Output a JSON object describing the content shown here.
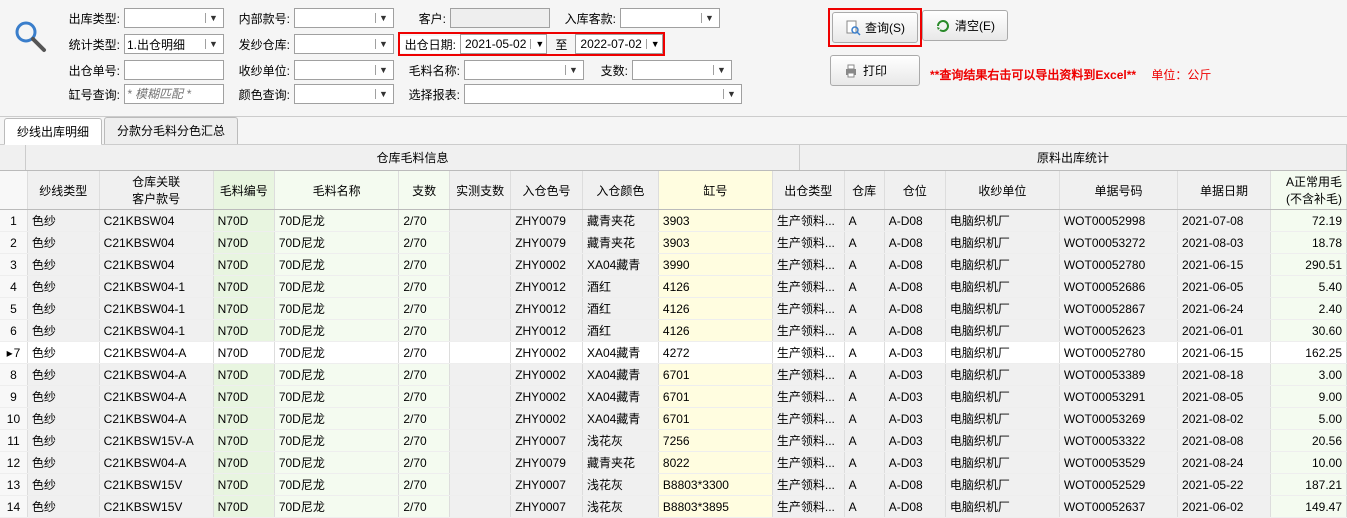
{
  "toolbar": {
    "labels": {
      "out_type": "出库类型:",
      "inner_no": "内部款号:",
      "customer": "客户:",
      "in_style": "入库客款:",
      "stat_type": "统计类型:",
      "yarn_wh": "发纱仓库:",
      "out_date": "出仓日期:",
      "date_sep": "至",
      "out_no": "出仓单号:",
      "recv_unit": "收纱单位:",
      "mat_name": "毛料名称:",
      "count": "支数:",
      "vat_query": "缸号查询:",
      "color_query": "颜色查询:",
      "report": "选择报表:"
    },
    "values": {
      "stat_type": "1.出仓明细",
      "date_from": "2021-05-02",
      "date_to": "2022-07-02",
      "vat_placeholder": "* 模糊匹配 *"
    },
    "buttons": {
      "query": "查询(S)",
      "clear": "清空(E)",
      "print": "打印"
    },
    "note": "**查询结果右击可以导出资料到Excel**",
    "unit": "单位：公斤"
  },
  "tabs": [
    "纱线出库明细",
    "分款分毛料分色汇总"
  ],
  "header_groups": {
    "g1": "仓库毛料信息",
    "g2": "原料出库统计"
  },
  "columns": [
    "",
    "纱线类型",
    "仓库关联\n客户款号",
    "毛料编号",
    "毛料名称",
    "支数",
    "实测支数",
    "入仓色号",
    "入仓颜色",
    "缸号",
    "出仓类型",
    "仓库",
    "仓位",
    "收纱单位",
    "单据号码",
    "单据日期",
    "A正常用毛\n(不含补毛)"
  ],
  "rows": [
    {
      "n": 1,
      "yarn": "色纱",
      "cust": "C21KBSW04",
      "code": "N70D",
      "name": "70D尼龙",
      "cnt": "2/70",
      "act": "",
      "clr": "ZHY0079",
      "clrn": "藏青夹花",
      "vat": "3903",
      "otype": "生产领料...",
      "wh": "A",
      "bin": "A-D08",
      "recv": "电脑织机厂",
      "bill": "WOT00052998",
      "date": "2021-07-08",
      "amt": "72.19"
    },
    {
      "n": 2,
      "yarn": "色纱",
      "cust": "C21KBSW04",
      "code": "N70D",
      "name": "70D尼龙",
      "cnt": "2/70",
      "act": "",
      "clr": "ZHY0079",
      "clrn": "藏青夹花",
      "vat": "3903",
      "otype": "生产领料...",
      "wh": "A",
      "bin": "A-D08",
      "recv": "电脑织机厂",
      "bill": "WOT00053272",
      "date": "2021-08-03",
      "amt": "18.78"
    },
    {
      "n": 3,
      "yarn": "色纱",
      "cust": "C21KBSW04",
      "code": "N70D",
      "name": "70D尼龙",
      "cnt": "2/70",
      "act": "",
      "clr": "ZHY0002",
      "clrn": "XA04藏青",
      "vat": "3990",
      "otype": "生产领料...",
      "wh": "A",
      "bin": "A-D08",
      "recv": "电脑织机厂",
      "bill": "WOT00052780",
      "date": "2021-06-15",
      "amt": "290.51"
    },
    {
      "n": 4,
      "yarn": "色纱",
      "cust": "C21KBSW04-1",
      "code": "N70D",
      "name": "70D尼龙",
      "cnt": "2/70",
      "act": "",
      "clr": "ZHY0012",
      "clrn": "酒红",
      "vat": "4126",
      "otype": "生产领料...",
      "wh": "A",
      "bin": "A-D08",
      "recv": "电脑织机厂",
      "bill": "WOT00052686",
      "date": "2021-06-05",
      "amt": "5.40"
    },
    {
      "n": 5,
      "yarn": "色纱",
      "cust": "C21KBSW04-1",
      "code": "N70D",
      "name": "70D尼龙",
      "cnt": "2/70",
      "act": "",
      "clr": "ZHY0012",
      "clrn": "酒红",
      "vat": "4126",
      "otype": "生产领料...",
      "wh": "A",
      "bin": "A-D08",
      "recv": "电脑织机厂",
      "bill": "WOT00052867",
      "date": "2021-06-24",
      "amt": "2.40"
    },
    {
      "n": 6,
      "yarn": "色纱",
      "cust": "C21KBSW04-1",
      "code": "N70D",
      "name": "70D尼龙",
      "cnt": "2/70",
      "act": "",
      "clr": "ZHY0012",
      "clrn": "酒红",
      "vat": "4126",
      "otype": "生产领料...",
      "wh": "A",
      "bin": "A-D08",
      "recv": "电脑织机厂",
      "bill": "WOT00052623",
      "date": "2021-06-01",
      "amt": "30.60"
    },
    {
      "n": 7,
      "yarn": "色纱",
      "cust": "C21KBSW04-A",
      "code": "N70D",
      "name": "70D尼龙",
      "cnt": "2/70",
      "act": "",
      "clr": "ZHY0002",
      "clrn": "XA04藏青",
      "vat": "4272",
      "otype": "生产领料...",
      "wh": "A",
      "bin": "A-D03",
      "recv": "电脑织机厂",
      "bill": "WOT00052780",
      "date": "2021-06-15",
      "amt": "162.25",
      "sel": true
    },
    {
      "n": 8,
      "yarn": "色纱",
      "cust": "C21KBSW04-A",
      "code": "N70D",
      "name": "70D尼龙",
      "cnt": "2/70",
      "act": "",
      "clr": "ZHY0002",
      "clrn": "XA04藏青",
      "vat": "6701",
      "otype": "生产领料...",
      "wh": "A",
      "bin": "A-D03",
      "recv": "电脑织机厂",
      "bill": "WOT00053389",
      "date": "2021-08-18",
      "amt": "3.00"
    },
    {
      "n": 9,
      "yarn": "色纱",
      "cust": "C21KBSW04-A",
      "code": "N70D",
      "name": "70D尼龙",
      "cnt": "2/70",
      "act": "",
      "clr": "ZHY0002",
      "clrn": "XA04藏青",
      "vat": "6701",
      "otype": "生产领料...",
      "wh": "A",
      "bin": "A-D03",
      "recv": "电脑织机厂",
      "bill": "WOT00053291",
      "date": "2021-08-05",
      "amt": "9.00"
    },
    {
      "n": 10,
      "yarn": "色纱",
      "cust": "C21KBSW04-A",
      "code": "N70D",
      "name": "70D尼龙",
      "cnt": "2/70",
      "act": "",
      "clr": "ZHY0002",
      "clrn": "XA04藏青",
      "vat": "6701",
      "otype": "生产领料...",
      "wh": "A",
      "bin": "A-D03",
      "recv": "电脑织机厂",
      "bill": "WOT00053269",
      "date": "2021-08-02",
      "amt": "5.00"
    },
    {
      "n": 11,
      "yarn": "色纱",
      "cust": "C21KBSW15V-A",
      "code": "N70D",
      "name": "70D尼龙",
      "cnt": "2/70",
      "act": "",
      "clr": "ZHY0007",
      "clrn": "浅花灰",
      "vat": "7256",
      "otype": "生产领料...",
      "wh": "A",
      "bin": "A-D03",
      "recv": "电脑织机厂",
      "bill": "WOT00053322",
      "date": "2021-08-08",
      "amt": "20.56"
    },
    {
      "n": 12,
      "yarn": "色纱",
      "cust": "C21KBSW04-A",
      "code": "N70D",
      "name": "70D尼龙",
      "cnt": "2/70",
      "act": "",
      "clr": "ZHY0079",
      "clrn": "藏青夹花",
      "vat": "8022",
      "otype": "生产领料...",
      "wh": "A",
      "bin": "A-D03",
      "recv": "电脑织机厂",
      "bill": "WOT00053529",
      "date": "2021-08-24",
      "amt": "10.00"
    },
    {
      "n": 13,
      "yarn": "色纱",
      "cust": "C21KBSW15V",
      "code": "N70D",
      "name": "70D尼龙",
      "cnt": "2/70",
      "act": "",
      "clr": "ZHY0007",
      "clrn": "浅花灰",
      "vat": "B8803*3300",
      "otype": "生产领料...",
      "wh": "A",
      "bin": "A-D08",
      "recv": "电脑织机厂",
      "bill": "WOT00052529",
      "date": "2021-05-22",
      "amt": "187.21"
    },
    {
      "n": 14,
      "yarn": "色纱",
      "cust": "C21KBSW15V",
      "code": "N70D",
      "name": "70D尼龙",
      "cnt": "2/70",
      "act": "",
      "clr": "ZHY0007",
      "clrn": "浅花灰",
      "vat": "B8803*3895",
      "otype": "生产领料...",
      "wh": "A",
      "bin": "A-D08",
      "recv": "电脑织机厂",
      "bill": "WOT00052637",
      "date": "2021-06-02",
      "amt": "149.47"
    }
  ]
}
